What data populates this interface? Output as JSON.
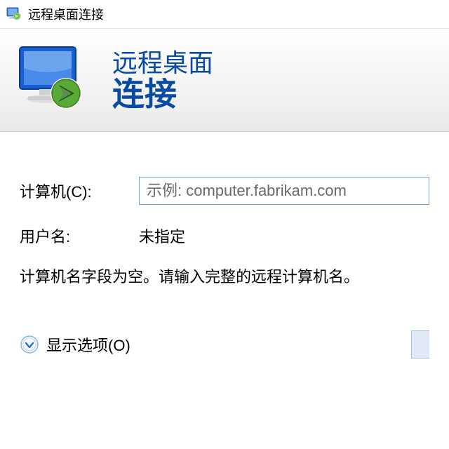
{
  "titlebar": {
    "title": "远程桌面连接"
  },
  "header": {
    "line1": "远程桌面",
    "line2": "连接"
  },
  "form": {
    "computer_label": "计算机(C):",
    "computer_placeholder": "示例: computer.fabrikam.com",
    "username_label": "用户名:",
    "username_value": "未指定",
    "hint": "计算机名字段为空。请输入完整的远程计算机名。"
  },
  "footer": {
    "show_options_label": "显示选项(O)"
  }
}
